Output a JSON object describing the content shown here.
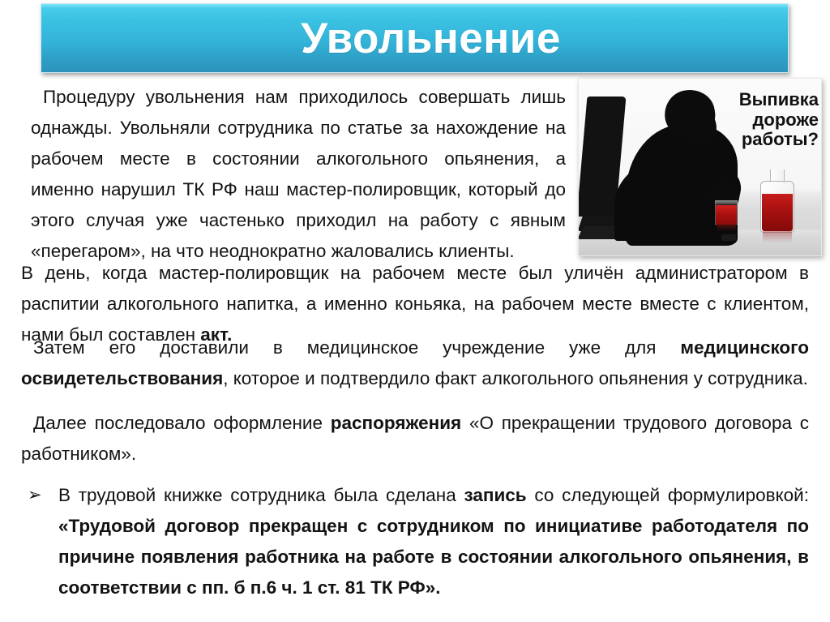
{
  "slide": {
    "title": "Увольнение",
    "banner_color_top": "#7fe6f8",
    "banner_color_bottom": "#2d93ba",
    "title_color": "#ffffff",
    "background_color": "#ffffff"
  },
  "photo": {
    "alt_name": "silhouette-man-drinking-at-computer",
    "caption_line_1": "Выпивка",
    "caption_line_2": "дороже",
    "caption_line_3": "работы?",
    "liquid_color": "#a71010"
  },
  "body": {
    "para_1_part_1": "Процедуру увольнения нам приходилось совершать лишь однажды. Увольняли сотрудника по статье за нахождение на рабочем месте в состоянии алкогольного опьянения, а именно нарушил ТК РФ наш мастер-полировщик, который до этого случая уже частенько приходил на работу с явным «перегаром», на что неоднократно жаловались клиенты.",
    "para_2_part_1": "В день, когда мастер-полировщик на рабочем месте был уличён администратором в распитии алкогольного напитка, а именно коньяка, на рабочем месте вместе с клиентом, нами был составлен ",
    "para_2_bold": "акт.",
    "para_3_part_1": "Затем его доставили в медицинское учреждение уже для ",
    "para_3_bold": "медицинского освидетельствования",
    "para_3_part_2": ", которое и подтвердило факт алкогольного опьянения у сотрудника.",
    "para_4_part_1": "Далее последовало оформление ",
    "para_4_bold": "распоряжения",
    "para_4_part_2": " «О прекращении трудового договора с работником»."
  },
  "bullet": {
    "marker": "➢",
    "text_part_1": "В трудовой книжке сотрудника была сделана ",
    "bold_1": "запись",
    "text_part_2": " со следующей формулировкой: ",
    "bold_2": "«Трудовой договор прекращен с сотрудником по инициативе работодателя по причине появления работника на работе в состоянии алкогольного опьянения, в соответствии с пп. б п.6 ч. 1 ст. 81 ТК РФ»."
  }
}
